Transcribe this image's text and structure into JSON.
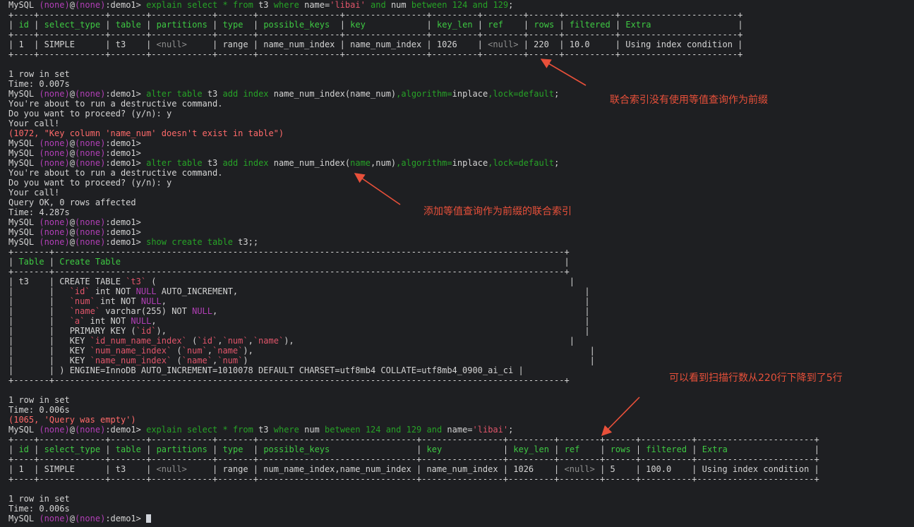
{
  "colors": {
    "background": "#1e1f22",
    "text": "#d4d4d4",
    "keyword": "#27a327",
    "prompt_var": "#b13fb6",
    "string": "#e0556a",
    "error": "#ff6a6a",
    "null": "#8e8e8e",
    "header": "#3ec943",
    "annotation": "#e8503a"
  },
  "lines": [
    {
      "segs": [
        [
          "MySQL ",
          ""
        ],
        [
          "(none)",
          "pv"
        ],
        [
          "@",
          ""
        ],
        [
          "(none)",
          "pv"
        ],
        [
          ":demo1> ",
          ""
        ],
        [
          "explain select * from ",
          "kw"
        ],
        [
          "t3 ",
          ""
        ],
        [
          "where ",
          "kw"
        ],
        [
          "name=",
          ""
        ],
        [
          "'libai'",
          "str"
        ],
        [
          " and ",
          "kw"
        ],
        [
          "num ",
          ""
        ],
        [
          "between 124 and 129",
          "kw"
        ],
        [
          ";",
          ""
        ]
      ]
    },
    {
      "segs": [
        [
          "+----+-------------+-------+------------+-------+----------------+----------------+---------+--------+------+----------+-----------------------+",
          ""
        ]
      ]
    },
    {
      "segs": [
        [
          "| ",
          ""
        ],
        [
          "id",
          "hd"
        ],
        [
          " | ",
          ""
        ],
        [
          "select_type",
          "hd"
        ],
        [
          " | ",
          ""
        ],
        [
          "table",
          "hd"
        ],
        [
          " | ",
          ""
        ],
        [
          "partitions",
          "hd"
        ],
        [
          " | ",
          ""
        ],
        [
          "type",
          "hd"
        ],
        [
          "  | ",
          ""
        ],
        [
          "possible_keys",
          "hd"
        ],
        [
          "  | ",
          ""
        ],
        [
          "key",
          "hd"
        ],
        [
          "            | ",
          ""
        ],
        [
          "key_len",
          "hd"
        ],
        [
          " | ",
          ""
        ],
        [
          "ref",
          "hd"
        ],
        [
          "    | ",
          ""
        ],
        [
          "rows",
          "hd"
        ],
        [
          " | ",
          ""
        ],
        [
          "filtered",
          "hd"
        ],
        [
          " | ",
          ""
        ],
        [
          "Extra",
          "hd"
        ],
        [
          "                 |",
          ""
        ]
      ]
    },
    {
      "segs": [
        [
          "+----+-------------+-------+------------+-------+----------------+----------------+---------+--------+------+----------+-----------------------+",
          ""
        ]
      ]
    },
    {
      "segs": [
        [
          "| 1  | SIMPLE      | t3    | ",
          ""
        ],
        [
          "<null>",
          "nl"
        ],
        [
          "     | range | name_num_index | name_num_index | 1026    | ",
          ""
        ],
        [
          "<null>",
          "nl"
        ],
        [
          " | 220  | 10.0     | Using index condition |",
          ""
        ]
      ]
    },
    {
      "segs": [
        [
          "+----+-------------+-------+------------+-------+----------------+----------------+---------+--------+------+----------+-----------------------+",
          ""
        ]
      ]
    },
    {
      "segs": []
    },
    {
      "segs": [
        [
          "1 row in set",
          ""
        ]
      ]
    },
    {
      "segs": [
        [
          "Time: 0.007s",
          ""
        ]
      ]
    },
    {
      "segs": [
        [
          "MySQL ",
          ""
        ],
        [
          "(none)",
          "pv"
        ],
        [
          "@",
          ""
        ],
        [
          "(none)",
          "pv"
        ],
        [
          ":demo1> ",
          ""
        ],
        [
          "alter table ",
          "kw"
        ],
        [
          "t3 ",
          ""
        ],
        [
          "add index ",
          "kw"
        ],
        [
          "name_num_index(name_num)",
          ""
        ],
        [
          ",algorithm=",
          "kw"
        ],
        [
          "inplace",
          ""
        ],
        [
          ",lock=default",
          "kw"
        ],
        [
          ";",
          ""
        ]
      ]
    },
    {
      "segs": [
        [
          "You're about to run a destructive command.",
          ""
        ]
      ]
    },
    {
      "segs": [
        [
          "Do you want to proceed? (y/n): y",
          ""
        ]
      ]
    },
    {
      "segs": [
        [
          "Your call!",
          ""
        ]
      ]
    },
    {
      "segs": [
        [
          "(1072, \"Key column 'name_num' doesn't exist in table\")",
          "err"
        ]
      ]
    },
    {
      "segs": [
        [
          "MySQL ",
          ""
        ],
        [
          "(none)",
          "pv"
        ],
        [
          "@",
          ""
        ],
        [
          "(none)",
          "pv"
        ],
        [
          ":demo1>",
          ""
        ]
      ]
    },
    {
      "segs": [
        [
          "MySQL ",
          ""
        ],
        [
          "(none)",
          "pv"
        ],
        [
          "@",
          ""
        ],
        [
          "(none)",
          "pv"
        ],
        [
          ":demo1>",
          ""
        ]
      ]
    },
    {
      "segs": [
        [
          "MySQL ",
          ""
        ],
        [
          "(none)",
          "pv"
        ],
        [
          "@",
          ""
        ],
        [
          "(none)",
          "pv"
        ],
        [
          ":demo1> ",
          ""
        ],
        [
          "alter table ",
          "kw"
        ],
        [
          "t3 ",
          ""
        ],
        [
          "add index ",
          "kw"
        ],
        [
          "name_num_index(",
          ""
        ],
        [
          "name",
          "kw"
        ],
        [
          ",num)",
          ""
        ],
        [
          ",algorithm=",
          "kw"
        ],
        [
          "inplace",
          ""
        ],
        [
          ",lock=default",
          "kw"
        ],
        [
          ";",
          ""
        ]
      ]
    },
    {
      "segs": [
        [
          "You're about to run a destructive command.",
          ""
        ]
      ]
    },
    {
      "segs": [
        [
          "Do you want to proceed? (y/n): y",
          ""
        ]
      ]
    },
    {
      "segs": [
        [
          "Your call!",
          ""
        ]
      ]
    },
    {
      "segs": [
        [
          "Query OK, 0 rows affected",
          ""
        ]
      ]
    },
    {
      "segs": [
        [
          "Time: 4.287s",
          ""
        ]
      ]
    },
    {
      "segs": [
        [
          "MySQL ",
          ""
        ],
        [
          "(none)",
          "pv"
        ],
        [
          "@",
          ""
        ],
        [
          "(none)",
          "pv"
        ],
        [
          ":demo1>",
          ""
        ]
      ]
    },
    {
      "segs": [
        [
          "MySQL ",
          ""
        ],
        [
          "(none)",
          "pv"
        ],
        [
          "@",
          ""
        ],
        [
          "(none)",
          "pv"
        ],
        [
          ":demo1>",
          ""
        ]
      ]
    },
    {
      "segs": [
        [
          "MySQL ",
          ""
        ],
        [
          "(none)",
          "pv"
        ],
        [
          "@",
          ""
        ],
        [
          "(none)",
          "pv"
        ],
        [
          ":demo1> ",
          ""
        ],
        [
          "show create table ",
          "kw"
        ],
        [
          "t3;;",
          ""
        ]
      ]
    },
    {
      "segs": [
        [
          "+-------+----------------------------------------------------------------------------------------------------+",
          ""
        ]
      ]
    },
    {
      "segs": [
        [
          "| ",
          ""
        ],
        [
          "Table",
          "hd"
        ],
        [
          " | ",
          ""
        ],
        [
          "Create Table",
          "hd"
        ],
        [
          "                                                                                       |",
          ""
        ]
      ]
    },
    {
      "segs": [
        [
          "+-------+----------------------------------------------------------------------------------------------------+",
          ""
        ]
      ]
    },
    {
      "segs": [
        [
          "| t3    | CREATE TABLE ",
          ""
        ],
        [
          "`t3`",
          "str"
        ],
        [
          " (                                                                                 |",
          ""
        ]
      ]
    },
    {
      "segs": [
        [
          "|       |   ",
          ""
        ],
        [
          "`id`",
          "str"
        ],
        [
          " int NOT ",
          ""
        ],
        [
          "NULL",
          "pv"
        ],
        [
          " AUTO_INCREMENT,                                                                    |",
          ""
        ]
      ]
    },
    {
      "segs": [
        [
          "|       |   ",
          ""
        ],
        [
          "`num`",
          "str"
        ],
        [
          " int NOT ",
          ""
        ],
        [
          "NULL",
          "pv"
        ],
        [
          ",                                                                                  |",
          ""
        ]
      ]
    },
    {
      "segs": [
        [
          "|       |   ",
          ""
        ],
        [
          "`name`",
          "str"
        ],
        [
          " varchar(255) NOT ",
          ""
        ],
        [
          "NULL",
          "pv"
        ],
        [
          ",                                                                        |",
          ""
        ]
      ]
    },
    {
      "segs": [
        [
          "|       |   ",
          ""
        ],
        [
          "`a`",
          "str"
        ],
        [
          " int NOT ",
          ""
        ],
        [
          "NULL",
          "pv"
        ],
        [
          ",                                                                                    |",
          ""
        ]
      ]
    },
    {
      "segs": [
        [
          "|       |   PRIMARY KEY (",
          ""
        ],
        [
          "`id`",
          "str"
        ],
        [
          "),                                                                                  |",
          ""
        ]
      ]
    },
    {
      "segs": [
        [
          "|       |   KEY ",
          ""
        ],
        [
          "`id_num_name_index`",
          "str"
        ],
        [
          " (",
          ""
        ],
        [
          "`id`",
          "str"
        ],
        [
          ",",
          ""
        ],
        [
          "`num`",
          "str"
        ],
        [
          ",",
          ""
        ],
        [
          "`name`",
          "str"
        ],
        [
          "),                                                      |",
          ""
        ]
      ]
    },
    {
      "segs": [
        [
          "|       |   KEY ",
          ""
        ],
        [
          "`num_name_index`",
          "str"
        ],
        [
          " (",
          ""
        ],
        [
          "`num`",
          "str"
        ],
        [
          ",",
          ""
        ],
        [
          "`name`",
          "str"
        ],
        [
          "),                                                                  |",
          ""
        ]
      ]
    },
    {
      "segs": [
        [
          "|       |   KEY ",
          ""
        ],
        [
          "`name_num_index`",
          "str"
        ],
        [
          " (",
          ""
        ],
        [
          "`name`",
          "str"
        ],
        [
          ",",
          ""
        ],
        [
          "`num`",
          "str"
        ],
        [
          ")                                                                   |",
          ""
        ]
      ]
    },
    {
      "segs": [
        [
          "|       | ) ENGINE=InnoDB AUTO_INCREMENT=1010078 DEFAULT CHARSET=utf8mb4 COLLATE=utf8mb4_0900_ai_ci |",
          ""
        ]
      ]
    },
    {
      "segs": [
        [
          "+-------+----------------------------------------------------------------------------------------------------+",
          ""
        ]
      ]
    },
    {
      "segs": []
    },
    {
      "segs": [
        [
          "1 row in set",
          ""
        ]
      ]
    },
    {
      "segs": [
        [
          "Time: 0.006s",
          ""
        ]
      ]
    },
    {
      "segs": [
        [
          "(1065, 'Query was empty')",
          "err"
        ]
      ]
    },
    {
      "segs": [
        [
          "MySQL ",
          ""
        ],
        [
          "(none)",
          "pv"
        ],
        [
          "@",
          ""
        ],
        [
          "(none)",
          "pv"
        ],
        [
          ":demo1> ",
          ""
        ],
        [
          "explain select * from ",
          "kw"
        ],
        [
          "t3 ",
          ""
        ],
        [
          "where ",
          "kw"
        ],
        [
          "num ",
          ""
        ],
        [
          "between 124 and 129 and ",
          "kw"
        ],
        [
          "name=",
          ""
        ],
        [
          "'libai'",
          "str"
        ],
        [
          ";",
          ""
        ]
      ]
    },
    {
      "segs": [
        [
          "+----+-------------+-------+------------+-------+-------------------------------+----------------+---------+--------+------+----------+-----------------------+",
          ""
        ]
      ]
    },
    {
      "segs": [
        [
          "| ",
          ""
        ],
        [
          "id",
          "hd"
        ],
        [
          " | ",
          ""
        ],
        [
          "select_type",
          "hd"
        ],
        [
          " | ",
          ""
        ],
        [
          "table",
          "hd"
        ],
        [
          " | ",
          ""
        ],
        [
          "partitions",
          "hd"
        ],
        [
          " | ",
          ""
        ],
        [
          "type",
          "hd"
        ],
        [
          "  | ",
          ""
        ],
        [
          "possible_keys",
          "hd"
        ],
        [
          "                 | ",
          ""
        ],
        [
          "key",
          "hd"
        ],
        [
          "            | ",
          ""
        ],
        [
          "key_len",
          "hd"
        ],
        [
          " | ",
          ""
        ],
        [
          "ref",
          "hd"
        ],
        [
          "    | ",
          ""
        ],
        [
          "rows",
          "hd"
        ],
        [
          " | ",
          ""
        ],
        [
          "filtered",
          "hd"
        ],
        [
          " | ",
          ""
        ],
        [
          "Extra",
          "hd"
        ],
        [
          "                 |",
          ""
        ]
      ]
    },
    {
      "segs": [
        [
          "+----+-------------+-------+------------+-------+-------------------------------+----------------+---------+--------+------+----------+-----------------------+",
          ""
        ]
      ]
    },
    {
      "segs": [
        [
          "| 1  | SIMPLE      | t3    | ",
          ""
        ],
        [
          "<null>",
          "nl"
        ],
        [
          "     | range | num_name_index,name_num_index | name_num_index | 1026    | ",
          ""
        ],
        [
          "<null>",
          "nl"
        ],
        [
          " | 5    | 100.0    | Using index condition |",
          ""
        ]
      ]
    },
    {
      "segs": [
        [
          "+----+-------------+-------+------------+-------+-------------------------------+----------------+---------+--------+------+----------+-----------------------+",
          ""
        ]
      ]
    },
    {
      "segs": []
    },
    {
      "segs": [
        [
          "1 row in set",
          ""
        ]
      ]
    },
    {
      "segs": [
        [
          "Time: 0.006s",
          ""
        ]
      ]
    },
    {
      "segs": [
        [
          "MySQL ",
          ""
        ],
        [
          "(none)",
          "pv"
        ],
        [
          "@",
          ""
        ],
        [
          "(none)",
          "pv"
        ],
        [
          ":demo1> ",
          ""
        ]
      ],
      "cursor": true
    }
  ],
  "annotations": [
    {
      "id": "annotation-composite-index-not-equality-prefix",
      "text": "联合索引没有使用等值查询作为前缀"
    },
    {
      "id": "annotation-add-equality-prefix-index",
      "text": "添加等值查询作为前缀的联合索引"
    },
    {
      "id": "annotation-rows-dropped",
      "text": "可以看到扫描行数从220行下降到了5行"
    }
  ]
}
